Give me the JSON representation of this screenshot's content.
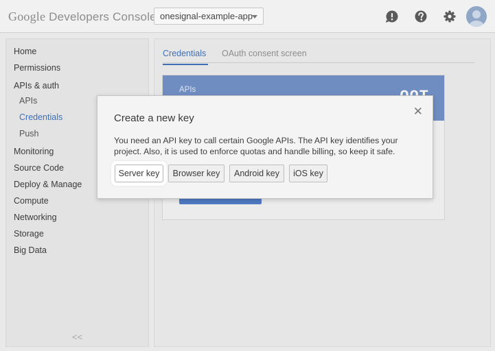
{
  "header": {
    "logo_google": "Google",
    "logo_product": "Developers Console",
    "project": "onesignal-example-app",
    "icons": [
      "feedback-icon",
      "help-icon",
      "gear-icon",
      "avatar"
    ]
  },
  "sidebar": {
    "items": [
      {
        "label": "Home"
      },
      {
        "label": "Permissions"
      },
      {
        "label": "APIs & auth"
      },
      {
        "label": "APIs"
      },
      {
        "label": "Credentials"
      },
      {
        "label": "Push"
      },
      {
        "label": "Monitoring"
      },
      {
        "label": "Source Code"
      },
      {
        "label": "Deploy & Manage"
      },
      {
        "label": "Compute"
      },
      {
        "label": "Networking"
      },
      {
        "label": "Storage"
      },
      {
        "label": "Big Data"
      }
    ],
    "collapse_label": "<<"
  },
  "main": {
    "tabs": [
      {
        "label": "Credentials"
      },
      {
        "label": "OAuth consent screen"
      }
    ],
    "card": {
      "header_label": "APIs",
      "header_icon_text": "OOT"
    }
  },
  "dialog": {
    "title": "Create a new key",
    "close": "✕",
    "text": "You need an API key to call certain Google APIs. The API key identifies your project. Also, it is used to enforce quotas and handle billing, so keep it safe.",
    "buttons": [
      {
        "label": "Server key"
      },
      {
        "label": "Browser key"
      },
      {
        "label": "Android key"
      },
      {
        "label": "iOS key"
      }
    ]
  },
  "colors": {
    "accent": "#3f6fb5",
    "card_header": "#6f8dc1",
    "card_button": "#4f7ac3"
  }
}
